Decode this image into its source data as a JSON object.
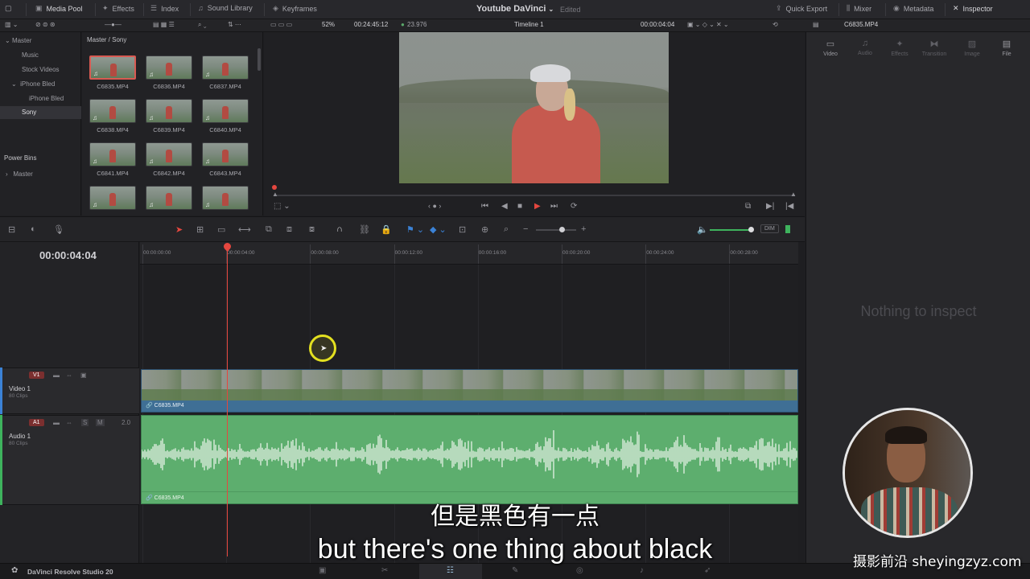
{
  "topbar": {
    "tabs": [
      {
        "label": "Media Pool",
        "icon": "media-pool-icon"
      },
      {
        "label": "Effects",
        "icon": "effects-icon"
      },
      {
        "label": "Index",
        "icon": "index-icon"
      },
      {
        "label": "Sound Library",
        "icon": "sound-library-icon"
      },
      {
        "label": "Keyframes",
        "icon": "keyframes-icon"
      }
    ],
    "project_title": "Youtube DaVinci",
    "status": "Edited",
    "right_tabs": [
      {
        "label": "Quick Export",
        "icon": "export-icon"
      },
      {
        "label": "Mixer",
        "icon": "mixer-icon"
      },
      {
        "label": "Metadata",
        "icon": "metadata-icon"
      },
      {
        "label": "Inspector",
        "icon": "inspector-icon"
      }
    ]
  },
  "viewer_bar": {
    "zoom": "52%",
    "source_timecode": "00:24:45:12",
    "fps": "23.976",
    "timeline_name": "Timeline 1",
    "record_timecode": "00:00:04:04",
    "clip_name": "C6835.MP4"
  },
  "bins": {
    "items": [
      "Master",
      "Music",
      "Stock Videos",
      "iPhone Bled",
      "iPhone Bled",
      "Sony"
    ],
    "power_bins_label": "Power Bins",
    "power_bins_master": "Master"
  },
  "media_pool": {
    "path": "Master / Sony",
    "clips": [
      "C6835.MP4",
      "C6836.MP4",
      "C6837.MP4",
      "C6838.MP4",
      "C6839.MP4",
      "C6840.MP4",
      "C6841.MP4",
      "C6842.MP4",
      "C6843.MP4",
      "",
      "",
      ""
    ]
  },
  "inspector": {
    "tabs": [
      "Video",
      "Audio",
      "Effects",
      "Transition",
      "Image",
      "File"
    ],
    "empty_text": "Nothing to inspect"
  },
  "timeline": {
    "timecode": "00:00:04:04",
    "ruler": [
      "00:00:00:00",
      "00:00:04:00",
      "00:00:08:00",
      "00:00:12:00",
      "00:00:16:00",
      "00:00:20:00",
      "00:00:24:00",
      "00:00:28:00"
    ],
    "dim_label": "DIM",
    "video_track": {
      "badge": "V1",
      "name": "Video 1",
      "clips_count": "80 Clips",
      "clip_label": "C6835.MP4"
    },
    "audio_track": {
      "badge": "A1",
      "name": "Audio 1",
      "clips_count": "80 Clips",
      "channel": "2.0",
      "solo": "S",
      "mute": "M",
      "clip_label": "C6835.MP4"
    }
  },
  "bottombar": {
    "app_name": "DaVinci Resolve Studio 20"
  },
  "subtitles": {
    "cn": "但是黑色有一点",
    "en": "but there's one thing about black"
  },
  "watermark": "摄影前沿 sheyingzyz.com",
  "colors": {
    "accent_red": "#e5473f",
    "video_clip": "#3f6f95",
    "audio_clip": "#5dae6e",
    "badge_red": "#7b2f2f"
  }
}
